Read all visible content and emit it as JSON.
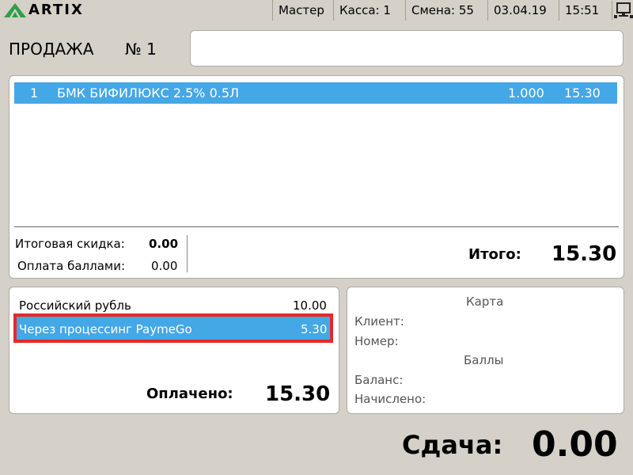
{
  "app": {
    "brand": "ARTIX"
  },
  "status_bar": {
    "user": "Мастер",
    "register": "Касса: 1",
    "shift": "Смена: 55",
    "date": "03.04.19",
    "time": "15:51"
  },
  "sale": {
    "label": "ПРОДАЖА",
    "number": "№ 1"
  },
  "receipt": {
    "items": [
      {
        "pos": "1",
        "name": "БМК БИФИЛЮКС 2.5% 0.5Л",
        "qty": "1.000",
        "sum": "15.30"
      }
    ],
    "discount_label": "Итоговая скидка:",
    "discount_value": "0.00",
    "points_label": "Оплата баллами:",
    "points_value": "0.00",
    "total_label": "Итого:",
    "total_value": "15.30"
  },
  "payments": {
    "items": [
      {
        "name": "Российский рубль",
        "amount": "10.00"
      },
      {
        "name": "Через процессинг PaymeGo",
        "amount": "5.30"
      }
    ],
    "paid_label": "Оплачено:",
    "paid_value": "15.30"
  },
  "card": {
    "title": "Карта",
    "client_label": "Клиент:",
    "number_label": "Номер:",
    "points_title": "Баллы",
    "balance_label": "Баланс:",
    "accrued_label": "Начислено:"
  },
  "change": {
    "label": "Сдача:",
    "value": "0.00"
  },
  "colors": {
    "accent": "#44a7e6",
    "highlight_border": "#e8262a",
    "background": "#d5d0c8",
    "logo_green": "#2e9f47"
  }
}
